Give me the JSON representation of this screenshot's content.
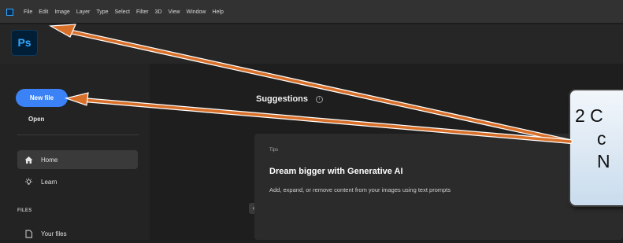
{
  "menubar": {
    "items": [
      "File",
      "Edit",
      "Image",
      "Layer",
      "Type",
      "Select",
      "Filter",
      "3D",
      "View",
      "Window",
      "Help"
    ]
  },
  "app": {
    "logo": "Ps"
  },
  "sidebar": {
    "new_file": "New file",
    "open": "Open",
    "nav": [
      {
        "label": "Home",
        "icon": "home-icon",
        "active": true
      },
      {
        "label": "Learn",
        "icon": "lightbulb-icon",
        "active": false
      }
    ],
    "files_header": "FILES",
    "files_nav": [
      {
        "label": "Your files",
        "icon": "file-icon"
      }
    ]
  },
  "main": {
    "suggestions_title": "Suggestions",
    "collapse_glyph": "‹",
    "tip_card": {
      "tag": "Tips",
      "title": "Dream bigger with Generative AI",
      "description": "Add, expand, or remove content from your images using text prompts"
    }
  },
  "callout": {
    "lines": [
      "2 C",
      "c",
      "N"
    ]
  },
  "colors": {
    "accent_blue": "#3b82f6",
    "arrow_orange": "#d9702a",
    "ps_blue": "#31a8ff"
  }
}
